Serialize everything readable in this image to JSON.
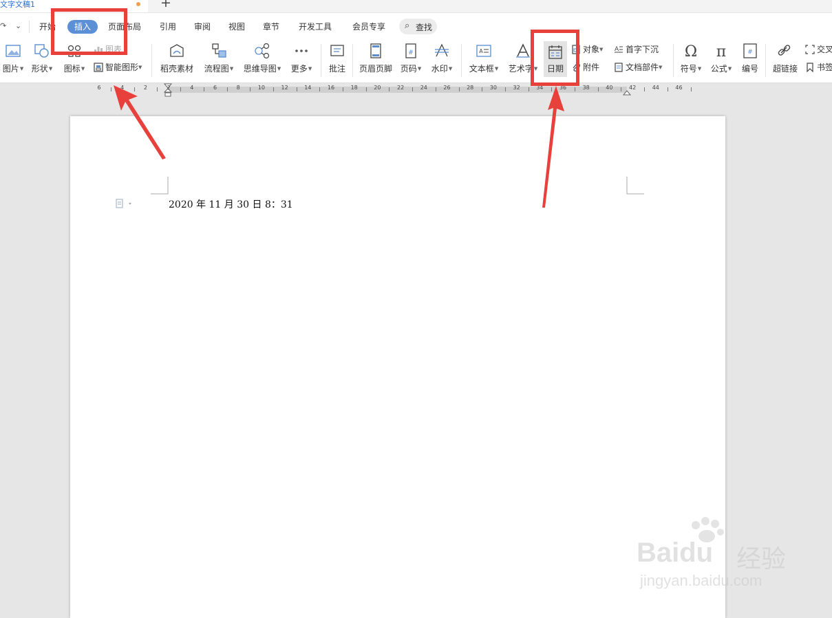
{
  "window": {
    "doc_tab_title": "文字文稿1",
    "new_tab": "+"
  },
  "quick_access": {
    "redo": "↷",
    "more": "⌄"
  },
  "menu": {
    "items": [
      "开始",
      "插入",
      "页面布局",
      "引用",
      "审阅",
      "视图",
      "章节",
      "开发工具",
      "会员专享"
    ],
    "active": "插入",
    "search_label": "查找"
  },
  "ribbon": {
    "picture": "图片",
    "shape": "形状",
    "icon": "图标",
    "chart": "图表",
    "smart_art": "智能图形",
    "daoke": "稻壳素材",
    "flowchart": "流程图",
    "mindmap": "思维导图",
    "more": "更多",
    "comment": "批注",
    "header_footer": "页眉页脚",
    "page_number": "页码",
    "watermark": "水印",
    "textbox": "文本框",
    "wordart": "艺术字",
    "date": "日期",
    "object": "对象",
    "attachment": "附件",
    "dropcap": "首字下沉",
    "doc_parts": "文档部件",
    "symbol": "符号",
    "formula": "公式",
    "numbering": "编号",
    "hyperlink": "超链接",
    "crossref": "交叉",
    "bookmark": "书签"
  },
  "ruler": {
    "labels": [
      "6",
      "4",
      "2",
      "2",
      "4",
      "6",
      "8",
      "10",
      "12",
      "14",
      "16",
      "18",
      "20",
      "22",
      "24",
      "26",
      "28",
      "30",
      "32",
      "34",
      "36",
      "38",
      "40",
      "42",
      "44",
      "46"
    ]
  },
  "document": {
    "text": "2020 年 11 月 30 日 8：31"
  },
  "watermark": {
    "brand": "Bai",
    "brand2": "du",
    "jingyan": "经验",
    "url": "jingyan.baidu.com"
  },
  "colors": {
    "accent": "#5b8fd6",
    "highlight": "#e8413c",
    "arrow": "#e8413c"
  }
}
